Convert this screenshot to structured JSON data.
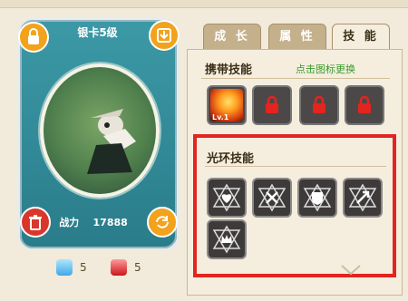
{
  "card": {
    "title": "银卡5级",
    "power_label": "战力",
    "power_value": "17888"
  },
  "resources": {
    "blue_count": "5",
    "red_count": "5"
  },
  "tabs": [
    {
      "label": "成 长",
      "active": false
    },
    {
      "label": "属 性",
      "active": false
    },
    {
      "label": "技 能",
      "active": true
    }
  ],
  "carry_skills": {
    "title": "携带技能",
    "hint": "点击图标更换",
    "slots": [
      {
        "level": "Lv.1",
        "locked": false
      },
      {
        "locked": true
      },
      {
        "locked": true
      },
      {
        "locked": true
      }
    ]
  },
  "aura_skills": {
    "title": "光环技能",
    "icons": [
      "heart-star-icon",
      "sword-star-icon",
      "shield-star-icon",
      "arrow-star-icon",
      "crown-star-icon"
    ]
  },
  "colors": {
    "highlight_box": "#e3241f",
    "hint_green": "#3a9a2b",
    "card_teal": "#2a7c8a"
  }
}
